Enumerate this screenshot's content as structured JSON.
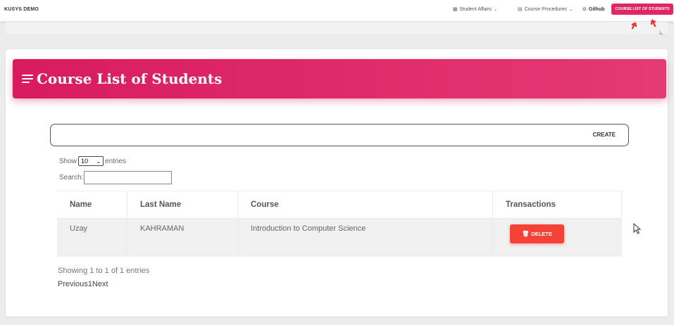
{
  "navbar": {
    "brand": "KUSYS DEMO",
    "items": [
      {
        "label": "Student Affairs",
        "icon": "grid-icon"
      },
      {
        "label": "Course Procedures",
        "icon": "list-icon"
      },
      {
        "label": "Github",
        "icon": "github-icon"
      }
    ],
    "active_button": "COURSE LIST OF STUDENTS"
  },
  "page": {
    "title": "Course List of Students",
    "create_label": "CREATE",
    "show_label": "Show",
    "entries_label": "entries",
    "page_length": "10",
    "search_label": "Search:",
    "search_value": "",
    "info": "Showing 1 to 1 of 1 entries",
    "pagination": {
      "previous": "Previous",
      "page": "1",
      "next": "Next"
    }
  },
  "table": {
    "headers": [
      "Name",
      "Last Name",
      "Course",
      "Transactions"
    ],
    "rows": [
      {
        "name": "Uzay",
        "last_name": "KAHRAMAN",
        "course": "Introduction to Computer Science",
        "action": "DELETE"
      }
    ]
  },
  "colors": {
    "accent": "#e02763",
    "header_gradient_start": "#d81b5e",
    "header_gradient_end": "#e43a74",
    "delete": "#f44336"
  }
}
